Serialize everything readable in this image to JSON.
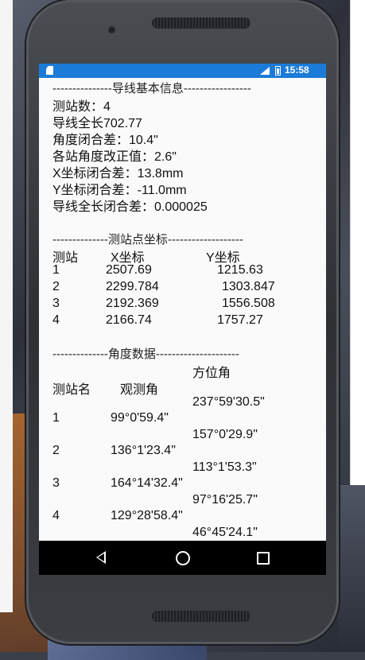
{
  "status_bar": {
    "time": "15:58",
    "network": "LTE"
  },
  "basic_info": {
    "header": "---------------导线基本信息-----------------",
    "lines": [
      "测站数：4",
      "导线全长702.77",
      "角度闭合差：10.4\"",
      "各站角度改正值：2.6\"",
      "X坐标闭合差：13.8mm",
      "Y坐标闭合差：-11.0mm",
      "导线全长闭合差：0.000025"
    ]
  },
  "coords": {
    "header": "--------------测站点坐标-------------------",
    "columns": [
      "测站",
      "X坐标",
      "Y坐标"
    ],
    "rows": [
      [
        "1",
        "2507.69",
        "1215.63"
      ],
      [
        "2",
        "2299.784",
        "1303.847"
      ],
      [
        "3",
        "2192.369",
        "1556.508"
      ],
      [
        "4",
        "2166.74",
        "1757.27"
      ]
    ]
  },
  "angles": {
    "header": "--------------角度数据---------------------",
    "col_station": "测站名",
    "col_observed": "观测角",
    "col_azimuth": "方位角",
    "azimuths": [
      "237°59'30.5\"",
      "157°0'29.9\"",
      "113°1'53.3\"",
      "97°16'25.7\"",
      "46°45'24.1\""
    ],
    "rows": [
      [
        "1",
        "99°0'59.4\""
      ],
      [
        "2",
        "136°1'23.4\""
      ],
      [
        "3",
        "164°14'32.4\""
      ],
      [
        "4",
        "129°28'58.4\""
      ]
    ]
  }
}
